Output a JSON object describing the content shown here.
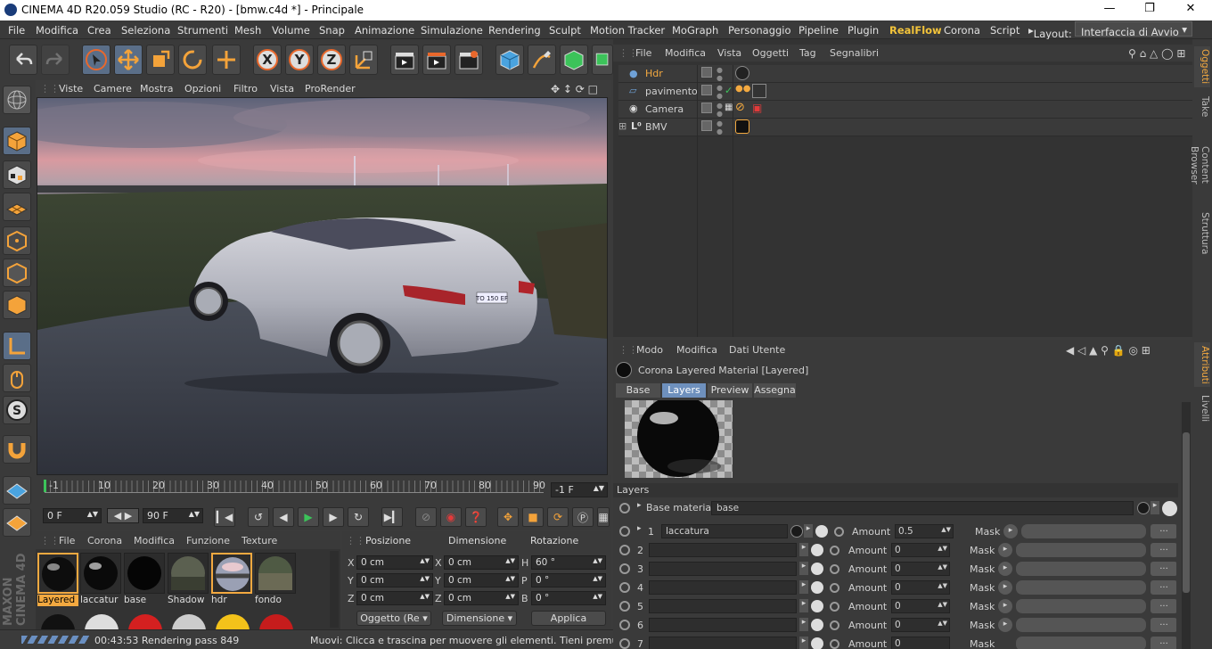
{
  "window": {
    "title": "CINEMA 4D R20.059 Studio (RC - R20) - [bmw.c4d *] - Principale"
  },
  "menubar": {
    "items": [
      "File",
      "Modifica",
      "Crea",
      "Seleziona",
      "Strumenti",
      "Mesh",
      "Volume",
      "Snap",
      "Animazione",
      "Simulazione",
      "Rendering",
      "Sculpt",
      "Motion Tracker",
      "MoGraph",
      "Personaggio",
      "Pipeline",
      "Plugin",
      "RealFlow",
      "Corona",
      "Script"
    ],
    "layout_label": "Layout:",
    "layout_value": "Interfaccia di Avvio",
    "accent": "#f3c43a"
  },
  "viewport": {
    "menu": [
      "Viste",
      "Camere",
      "Mostra",
      "Opzioni",
      "Filtro",
      "Vista",
      "ProRender"
    ],
    "plate_text": "TO 150 EF"
  },
  "timeline": {
    "ticks": [
      "0",
      "10",
      "20",
      "30",
      "40",
      "50",
      "60",
      "70",
      "80",
      "90"
    ],
    "current_frame_marker": "-1",
    "frame_end_field": "-1 F"
  },
  "transport": {
    "start_field": "0 F",
    "end_field": "90 F"
  },
  "materials": {
    "menu": [
      "File",
      "Corona",
      "Modifica",
      "Funzione",
      "Texture"
    ],
    "items": [
      {
        "label": "Layered",
        "selected": true
      },
      {
        "label": "laccatur",
        "selected": false
      },
      {
        "label": "base",
        "selected": false
      },
      {
        "label": "Shadow",
        "selected": false
      },
      {
        "label": "hdr",
        "selected": false
      },
      {
        "label": "fondo",
        "selected": false
      }
    ]
  },
  "coords": {
    "headers": [
      "Posizione",
      "Dimensione",
      "Rotazione"
    ],
    "rows": [
      {
        "p_axis": "X",
        "p_val": "0 cm",
        "d_axis": "X",
        "d_val": "0 cm",
        "r_axis": "H",
        "r_val": "60 °"
      },
      {
        "p_axis": "Y",
        "p_val": "0 cm",
        "d_axis": "Y",
        "d_val": "0 cm",
        "r_axis": "P",
        "r_val": "0 °"
      },
      {
        "p_axis": "Z",
        "p_val": "0 cm",
        "d_axis": "Z",
        "d_val": "0 cm",
        "r_axis": "B",
        "r_val": "0 °"
      }
    ],
    "mode_select": "Oggetto (Re",
    "dim_select": "Dimensione",
    "apply": "Applica"
  },
  "status": {
    "render": "00:43:53 Rendering pass 849",
    "hint": "Muovi: Clicca e trascina per muovere gli elementi. Tieni premuto S"
  },
  "objects": {
    "menu": [
      "File",
      "Modifica",
      "Vista",
      "Oggetti",
      "Tag",
      "Segnalibri"
    ],
    "rows": [
      {
        "name": "Hdr",
        "highlight": true
      },
      {
        "name": "pavimento",
        "highlight": false
      },
      {
        "name": "Camera",
        "highlight": false
      },
      {
        "name": "BMV",
        "highlight": false
      }
    ]
  },
  "attributes": {
    "menu": [
      "Modo",
      "Modifica",
      "Dati Utente"
    ],
    "title": "Corona Layered Material [Layered]",
    "tabs": [
      {
        "label": "Base",
        "active": false
      },
      {
        "label": "Layers",
        "active": true
      },
      {
        "label": "Preview",
        "active": false
      },
      {
        "label": "Assegna",
        "active": false
      }
    ],
    "section": "Layers",
    "base_label": "Base material",
    "base_value": "base",
    "amount_label": "Amount",
    "mask_label": "Mask",
    "dots": "...",
    "layers": [
      {
        "index": "1",
        "name": "laccatura",
        "amount": "0.5"
      },
      {
        "index": "2",
        "name": "",
        "amount": "0"
      },
      {
        "index": "3",
        "name": "",
        "amount": "0"
      },
      {
        "index": "4",
        "name": "",
        "amount": "0"
      },
      {
        "index": "5",
        "name": "",
        "amount": "0"
      },
      {
        "index": "6",
        "name": "",
        "amount": "0"
      },
      {
        "index": "7",
        "name": "",
        "amount": "0"
      }
    ]
  },
  "side_tabs": {
    "top": [
      "Oggetti",
      "Take",
      "Content Browser",
      "Struttura"
    ],
    "bottom": [
      "Attributi",
      "Livelli"
    ]
  },
  "brand": "MAXON CINEMA 4D"
}
